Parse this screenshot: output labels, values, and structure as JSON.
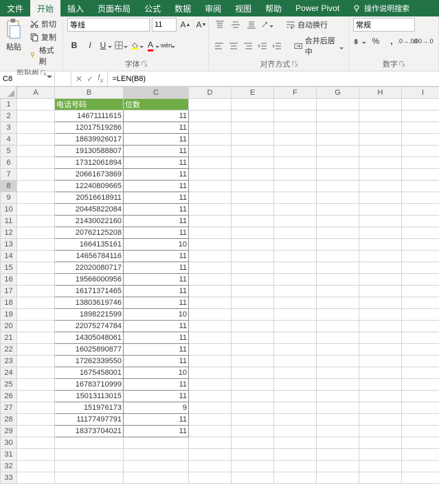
{
  "menu": {
    "tabs": [
      "文件",
      "开始",
      "插入",
      "页面布局",
      "公式",
      "数据",
      "审阅",
      "视图",
      "帮助",
      "Power Pivot"
    ],
    "activeIndex": 1,
    "searchHint": "操作说明搜索"
  },
  "ribbon": {
    "clipboard": {
      "paste": "粘贴",
      "cut": "剪切",
      "copy": "复制",
      "format": "格式刷",
      "label": "剪贴板"
    },
    "font": {
      "name": "等线",
      "size": "11",
      "label": "字体",
      "ruby": "wén"
    },
    "align": {
      "wrap": "自动换行",
      "merge": "合并后居中",
      "label": "对齐方式"
    },
    "number": {
      "format": "常规",
      "label": "数字"
    }
  },
  "formulaBar": {
    "cellRef": "C8",
    "formula": "=LEN(B8)"
  },
  "columns": [
    "A",
    "B",
    "C",
    "D",
    "E",
    "F",
    "G",
    "H",
    "I"
  ],
  "rowCount": 33,
  "headers": {
    "b": "电话号码",
    "c": "位数"
  },
  "chart_data": {
    "type": "table",
    "columns": [
      "电话号码",
      "位数"
    ],
    "rows": [
      [
        "14671111615",
        11
      ],
      [
        "12017519286",
        11
      ],
      [
        "18639926017",
        11
      ],
      [
        "19130588807",
        11
      ],
      [
        "17312061894",
        11
      ],
      [
        "20661673869",
        11
      ],
      [
        "12240809665",
        11
      ],
      [
        "20516618911",
        11
      ],
      [
        "20445822084",
        11
      ],
      [
        "21430022160",
        11
      ],
      [
        "20762125208",
        11
      ],
      [
        "1664135161",
        10
      ],
      [
        "14656784116",
        11
      ],
      [
        "22020080717",
        11
      ],
      [
        "19566000956",
        11
      ],
      [
        "16171371465",
        11
      ],
      [
        "13803619746",
        11
      ],
      [
        "1898221599",
        10
      ],
      [
        "22075274784",
        11
      ],
      [
        "14305048061",
        11
      ],
      [
        "16025890877",
        11
      ],
      [
        "17262339550",
        11
      ],
      [
        "1675458001",
        10
      ],
      [
        "16783710999",
        11
      ],
      [
        "15013113015",
        11
      ],
      [
        "151976173",
        9
      ],
      [
        "11177497791",
        11
      ],
      [
        "18373704021",
        11
      ]
    ]
  },
  "selectedCell": {
    "row": 8,
    "col": "C"
  }
}
